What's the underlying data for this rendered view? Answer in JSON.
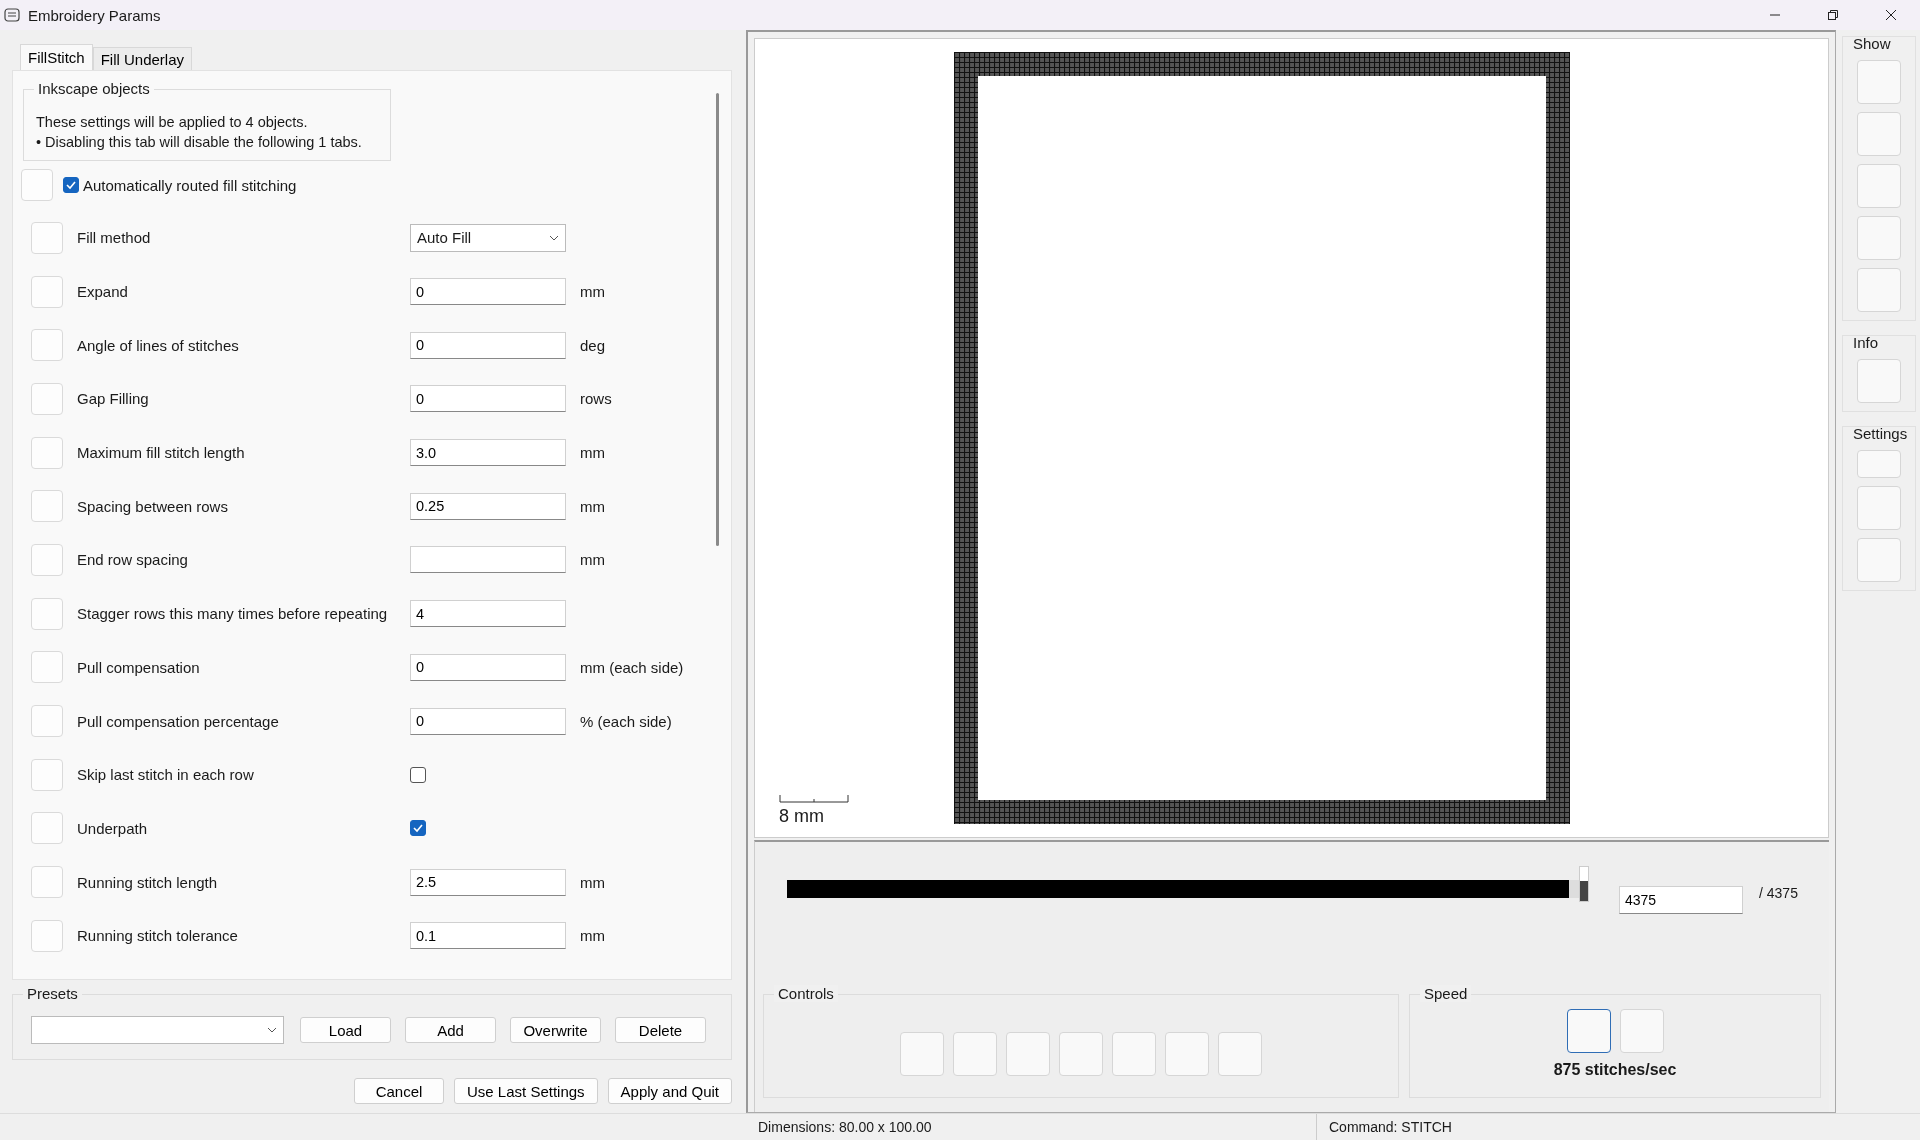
{
  "window": {
    "title": "Embroidery Params"
  },
  "tabs": [
    {
      "label": "FillStitch",
      "selected": true
    },
    {
      "label": "Fill Underlay",
      "selected": false
    }
  ],
  "inkscape_objects": {
    "title": "Inkscape objects",
    "lines": [
      "These settings will be applied to 4 objects.",
      "• Disabling this tab will disable the following 1 tabs."
    ]
  },
  "auto_routed": {
    "label": "Automatically routed fill stitching",
    "checked": true
  },
  "params": [
    {
      "kind": "dropdown",
      "label": "Fill method",
      "value": "Auto Fill"
    },
    {
      "kind": "field",
      "label": "Expand",
      "value": "0",
      "unit": "mm"
    },
    {
      "kind": "field",
      "label": "Angle of lines of stitches",
      "value": "0",
      "unit": "deg"
    },
    {
      "kind": "field",
      "label": "Gap Filling",
      "value": "0",
      "unit": "rows"
    },
    {
      "kind": "field",
      "label": "Maximum fill stitch length",
      "value": "3.0",
      "unit": "mm"
    },
    {
      "kind": "field",
      "label": "Spacing between rows",
      "value": "0.25",
      "unit": "mm"
    },
    {
      "kind": "field",
      "label": "End row spacing",
      "unit": "mm"
    },
    {
      "kind": "field",
      "label": "Stagger rows this many times before repeating",
      "value": "4"
    },
    {
      "kind": "field",
      "label": "Pull compensation",
      "value": "0",
      "unit": "mm (each side)"
    },
    {
      "kind": "field",
      "label": "Pull compensation percentage",
      "value": "0",
      "unit": "% (each side)"
    },
    {
      "kind": "checkbox",
      "label": "Skip last stitch in each row",
      "checked": false
    },
    {
      "kind": "checkbox",
      "label": "Underpath",
      "checked": true
    },
    {
      "kind": "field",
      "label": "Running stitch length",
      "value": "2.5",
      "unit": "mm"
    },
    {
      "kind": "field",
      "label": "Running stitch tolerance",
      "value": "0.1",
      "unit": "mm"
    }
  ],
  "presets": {
    "title": "Presets",
    "buttons": [
      "Load",
      "Add",
      "Overwrite",
      "Delete"
    ]
  },
  "dialog_buttons": [
    "Cancel",
    "Use Last Settings",
    "Apply and Quit"
  ],
  "preview": {
    "scale_label": "8 mm"
  },
  "playback": {
    "level": 1.0,
    "current": "4375",
    "total": "/ 4375"
  },
  "controls": {
    "title": "Controls"
  },
  "speed": {
    "title": "Speed",
    "buttons": [
      {
        "selected": true
      },
      {
        "selected": false
      }
    ],
    "reading": "875 stitches/sec"
  },
  "sidebar": [
    {
      "title": "Show"
    },
    {
      "title": "Info"
    },
    {
      "title": "Settings"
    }
  ],
  "status_bar": {
    "dimensions": "Dimensions: 80.00 x 100.00",
    "command": "Command: STITCH"
  }
}
